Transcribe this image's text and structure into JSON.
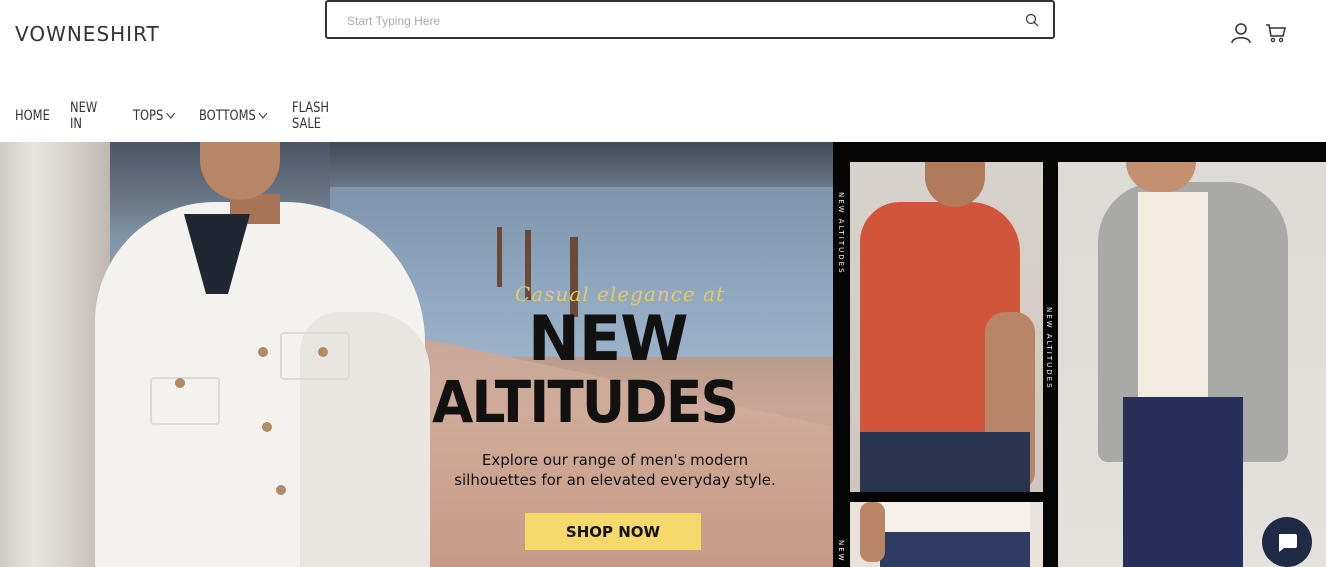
{
  "header": {
    "logo": "VOWNESHIRT",
    "search": {
      "placeholder": "Start Typing Here",
      "value": ""
    },
    "icons": [
      "search-icon",
      "user-icon",
      "cart-icon"
    ]
  },
  "nav": {
    "items": [
      {
        "label": "HOME",
        "has_dropdown": false
      },
      {
        "label": "NEW IN",
        "has_dropdown": false
      },
      {
        "label": "TOPS",
        "has_dropdown": true
      },
      {
        "label": "BOTTOMS",
        "has_dropdown": true
      },
      {
        "label": "FLASH SALE",
        "has_dropdown": false
      }
    ]
  },
  "hero": {
    "script_text": "Casual elegance at",
    "headline_line1": "NEW",
    "headline_line2": "ALTITUDES",
    "subtext_line1": "Explore our range of men's modern",
    "subtext_line2": "silhouettes for an elevated everyday style.",
    "cta_label": "SHOP NOW",
    "side_label_1": "NEW ALTITUDES",
    "side_label_2": "NEW ALTITUDES",
    "side_label_3": "NEW"
  },
  "colors": {
    "cta_background": "#f7d96b",
    "script_gold": "#e6c76a",
    "chat_button": "#1f2a44"
  },
  "chat": {
    "icon": "chat-bubble-icon"
  }
}
